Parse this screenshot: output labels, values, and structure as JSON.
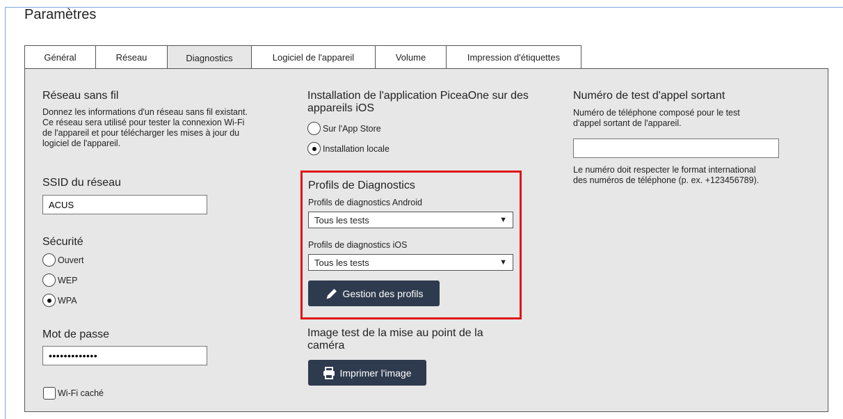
{
  "page": {
    "title": "Paramètres"
  },
  "tabs": [
    {
      "label": "Général",
      "active": false
    },
    {
      "label": "Réseau",
      "active": false
    },
    {
      "label": "Diagnostics",
      "active": true
    },
    {
      "label": "Logiciel de l'appareil",
      "active": false
    },
    {
      "label": "Volume",
      "active": false
    },
    {
      "label": "Impression d'étiquettes",
      "active": false
    }
  ],
  "wifi": {
    "title": "Réseau sans fil",
    "description": "Donnez les informations d'un réseau sans fil existant. Ce réseau sera utilisé pour tester la connexion Wi-Fi de l'appareil et pour télécharger les mises à jour du logiciel de l'appareil.",
    "ssid_label": "SSID du réseau",
    "ssid_value": "ACUS",
    "security_label": "Sécurité",
    "security_options": [
      {
        "label": "Ouvert",
        "selected": false
      },
      {
        "label": "WEP",
        "selected": false
      },
      {
        "label": "WPA",
        "selected": true
      }
    ],
    "password_label": "Mot de passe",
    "password_value": "•••••••••••••",
    "hidden_label": "Wi-Fi caché",
    "hidden_checked": false
  },
  "ios_install": {
    "title": "Installation de l'application PiceaOne sur des appareils iOS",
    "options": [
      {
        "label": "Sur l'App Store",
        "selected": false
      },
      {
        "label": "Installation locale",
        "selected": true
      }
    ]
  },
  "profiles": {
    "title": "Profils de Diagnostics",
    "android_label": "Profils de diagnostics Android",
    "android_value": "Tous les tests",
    "ios_label": "Profils de diagnostics iOS",
    "ios_value": "Tous les tests",
    "manage_button": "Gestion des profils",
    "highlight_color": "#e01414"
  },
  "camera": {
    "title": "Image test de la mise au point de la caméra",
    "print_button": "Imprimer l'image"
  },
  "outgoing_call": {
    "title": "Numéro de test d'appel sortant",
    "description": "Numéro de téléphone composé pour le test d'appel sortant de l'appareil.",
    "value": "",
    "note": "Le numéro doit respecter le format international des numéros de téléphone (p. ex. +123456789)."
  },
  "icons": {
    "edit": "pencil-icon",
    "print": "printer-icon",
    "dropdown": "triangle-down-icon"
  },
  "colors": {
    "panel": "#e7e7e7",
    "button": "#2e3a4e",
    "frame": "#7aa7d8"
  }
}
